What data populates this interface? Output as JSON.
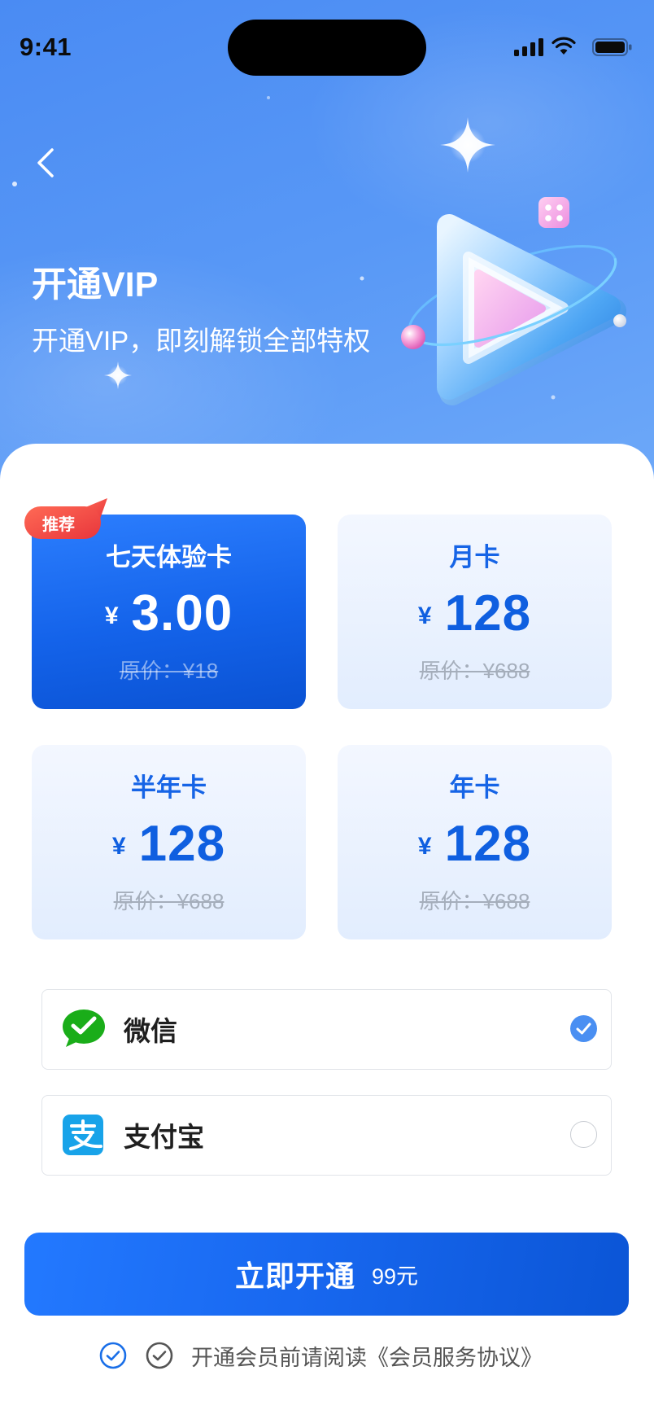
{
  "status_bar": {
    "time": "9:41",
    "icons": [
      "signal-icon",
      "wifi-icon",
      "battery-icon"
    ]
  },
  "header": {
    "back_icon": "chevron-left-icon",
    "title": "开通VIP",
    "subtitle": "开通VIP，即刻解锁全部特权",
    "illustration": "vip-play-illustration"
  },
  "plans": [
    {
      "name": "七天体验卡",
      "currency": "¥",
      "price": "3.00",
      "original_price": "原价：¥18",
      "selected": true,
      "badge": "推荐"
    },
    {
      "name": "月卡",
      "currency": "¥",
      "price": "128",
      "original_price": "原价：¥688",
      "selected": false
    },
    {
      "name": "半年卡",
      "currency": "¥",
      "price": "128",
      "original_price": "原价：¥688",
      "selected": false
    },
    {
      "name": "年卡",
      "currency": "¥",
      "price": "128",
      "original_price": "原价：¥688",
      "selected": false
    }
  ],
  "payment_methods": [
    {
      "name": "微信",
      "icon": "wechat-pay-icon",
      "selected": true
    },
    {
      "name": "支付宝",
      "icon": "alipay-icon",
      "selected": false
    }
  ],
  "cta": {
    "label": "立即开通",
    "amount": "99元"
  },
  "agreement": {
    "text": "开通会员前请阅读《会员服务协议》"
  },
  "colors": {
    "header_bg": "#5898F6",
    "accent": "#1466EE",
    "selected_card": "#1463EA",
    "unselected_card": "#EAF2FF",
    "badge": "#F04848",
    "radio_checked": "#4A8FF2",
    "wechat_green": "#1AAD19",
    "alipay_blue": "#18A3E9",
    "original_price_gray": "#A5AEBB"
  }
}
